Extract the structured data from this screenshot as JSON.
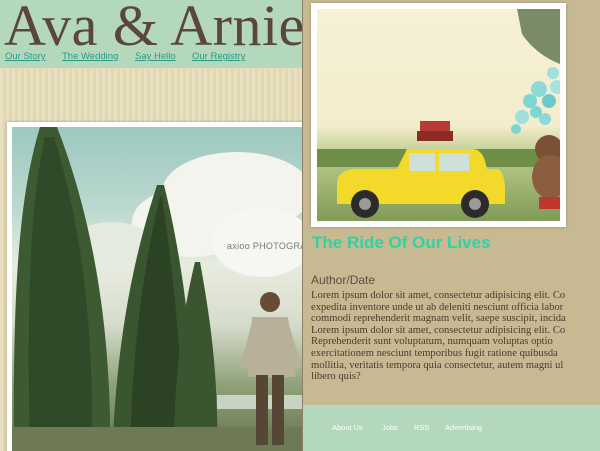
{
  "site": {
    "title": "Ava & Arnie"
  },
  "nav": {
    "items": [
      {
        "label": "Our Story"
      },
      {
        "label": "The Wedding"
      },
      {
        "label": "Say Hello"
      },
      {
        "label": "Our Registry"
      }
    ]
  },
  "hero": {
    "watermark": "axioo PHOTOGRA"
  },
  "post": {
    "title": "The Ride Of Our Lives",
    "meta": "Author/Date",
    "body_lines": [
      "Lorem ipsum dolor sit amet, consectetur adipisicing elit. Co",
      "expedita inventore unde ut ab deleniti nesciunt officia labor",
      "commodi reprehenderit magnam velit, saepe suscipit, incida",
      "Lorem ipsum dolor sit amet, consectetur adipisicing elit. Co",
      "Reprehenderit sunt voluptatum, numquam voluptas optio",
      "exercitationem nesciunt temporibus fugit ratione quibusda",
      "mollitia, veritatis tempora quia consectetur, autem magni ul",
      "libero quis?"
    ]
  },
  "footer": {
    "links": [
      {
        "label": "About Us"
      },
      {
        "label": "Jobs"
      },
      {
        "label": "RSS"
      },
      {
        "label": "Advertising"
      }
    ]
  },
  "colors": {
    "header_bg": "#b4d8bb",
    "title_brown": "#5a463e",
    "accent_green": "#2fd3a2",
    "link_teal": "#2a9a86",
    "panel_tan": "#c7b992"
  }
}
